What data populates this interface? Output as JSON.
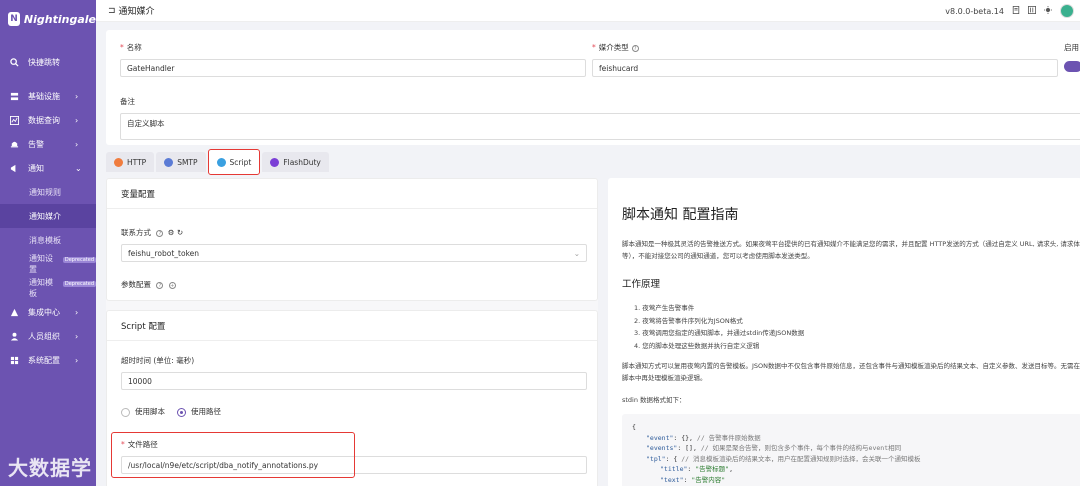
{
  "app": {
    "name": "Nightingale",
    "logo_letter": "N"
  },
  "header": {
    "back_glyph": "⊐",
    "title": "通知媒介",
    "version": "v8.0.0-beta.14"
  },
  "sidebar": {
    "items": [
      {
        "label": "快捷跳转",
        "icon": "search-icon"
      },
      {
        "label": "基础设施",
        "icon": "server-icon"
      },
      {
        "label": "数据查询",
        "icon": "chart-icon"
      },
      {
        "label": "告警",
        "icon": "bell-icon"
      },
      {
        "label": "通知",
        "icon": "megaphone-icon"
      },
      {
        "label": "集成中心",
        "icon": "plugin-icon"
      },
      {
        "label": "人员组织",
        "icon": "user-icon"
      },
      {
        "label": "系统配置",
        "icon": "settings-icon"
      }
    ],
    "sub_items": [
      {
        "label": "通知规则"
      },
      {
        "label": "通知媒介"
      },
      {
        "label": "消息模板"
      },
      {
        "label": "通知设置",
        "badge": "Deprecated"
      },
      {
        "label": "通知模板",
        "badge": "Deprecated"
      }
    ]
  },
  "form": {
    "name_label": "名称",
    "name_value": "GateHandler",
    "media_type_label": "媒介类型",
    "media_type_value": "feishucard",
    "enable_label": "启用",
    "enabled": true,
    "note_label": "备注",
    "note_value": "自定义脚本"
  },
  "tabs": [
    {
      "label": "HTTP",
      "color": "#f07c3e"
    },
    {
      "label": "SMTP",
      "color": "#5b7bd5"
    },
    {
      "label": "Script",
      "color": "#3aa0e0",
      "active": true
    },
    {
      "label": "FlashDuty",
      "color": "#7b3fd6"
    }
  ],
  "var_config": {
    "title": "变量配置",
    "contact_label": "联系方式",
    "contact_value": "feishu_robot_token",
    "param_label": "参数配置"
  },
  "script_config": {
    "title": "Script 配置",
    "timeout_label": "超时时间 (单位: 毫秒)",
    "timeout_value": "10000",
    "radio_script": "使用脚本",
    "radio_path": "使用路径",
    "selected": "path",
    "path_label": "文件路径",
    "path_value": "/usr/local/n9e/etc/script/dba_notify_annotations.py"
  },
  "guide": {
    "title": "脚本通知 配置指南",
    "intro": "脚本通知是一种极其灵活的告警推送方式。如果夜莺平台提供的已有通知媒介不能满足您的需求，并且配置 HTTP发送的方式（通过自定义 URL, 请求头, 请求体等），不能对接您公司的通知通道，您可以考虑使用脚本发送类型。",
    "h2": "工作原理",
    "steps": [
      "1. 夜莺产生告警事件",
      "2. 夜莺将告警事件序列化为JSON格式",
      "3. 夜莺调用您指定的通知脚本，并通过stdin传递JSON数据",
      "4. 您的脚本处理这些数据并执行自定义逻辑"
    ],
    "p2": "脚本通知方式可以复用夜莺内置的告警模板。JSON数据中不仅包含事件原始信息，还包含事件与通知模板渲染后的结果文本、自定义参数、发送目标等。无需在脚本中再处理模板渲染逻辑。",
    "stdin_label": "stdin 数据格式如下：",
    "code": {
      "open": "{",
      "l1_key": "\"event\"",
      "l1_val": ": {},",
      "l1_cmt": "// 告警事件原始数据",
      "l2_key": "\"events\"",
      "l2_val": ": [],",
      "l2_cmt": "// 如果是聚合告警，则包含多个事件，每个事件的结构与event相同",
      "l3_key": "\"tpl\"",
      "l3_val": ": {",
      "l3_cmt": "// 消息模板渲染后的结果文本，用户在配置通知规则时选择，会关联一个通知模板",
      "l4_key": "\"title\"",
      "l4_val": "\"告警标题\"",
      "l5_key": "\"text\"",
      "l5_val": "\"告警内容\"",
      "close": "},"
    }
  },
  "watermark": "大数据学习"
}
